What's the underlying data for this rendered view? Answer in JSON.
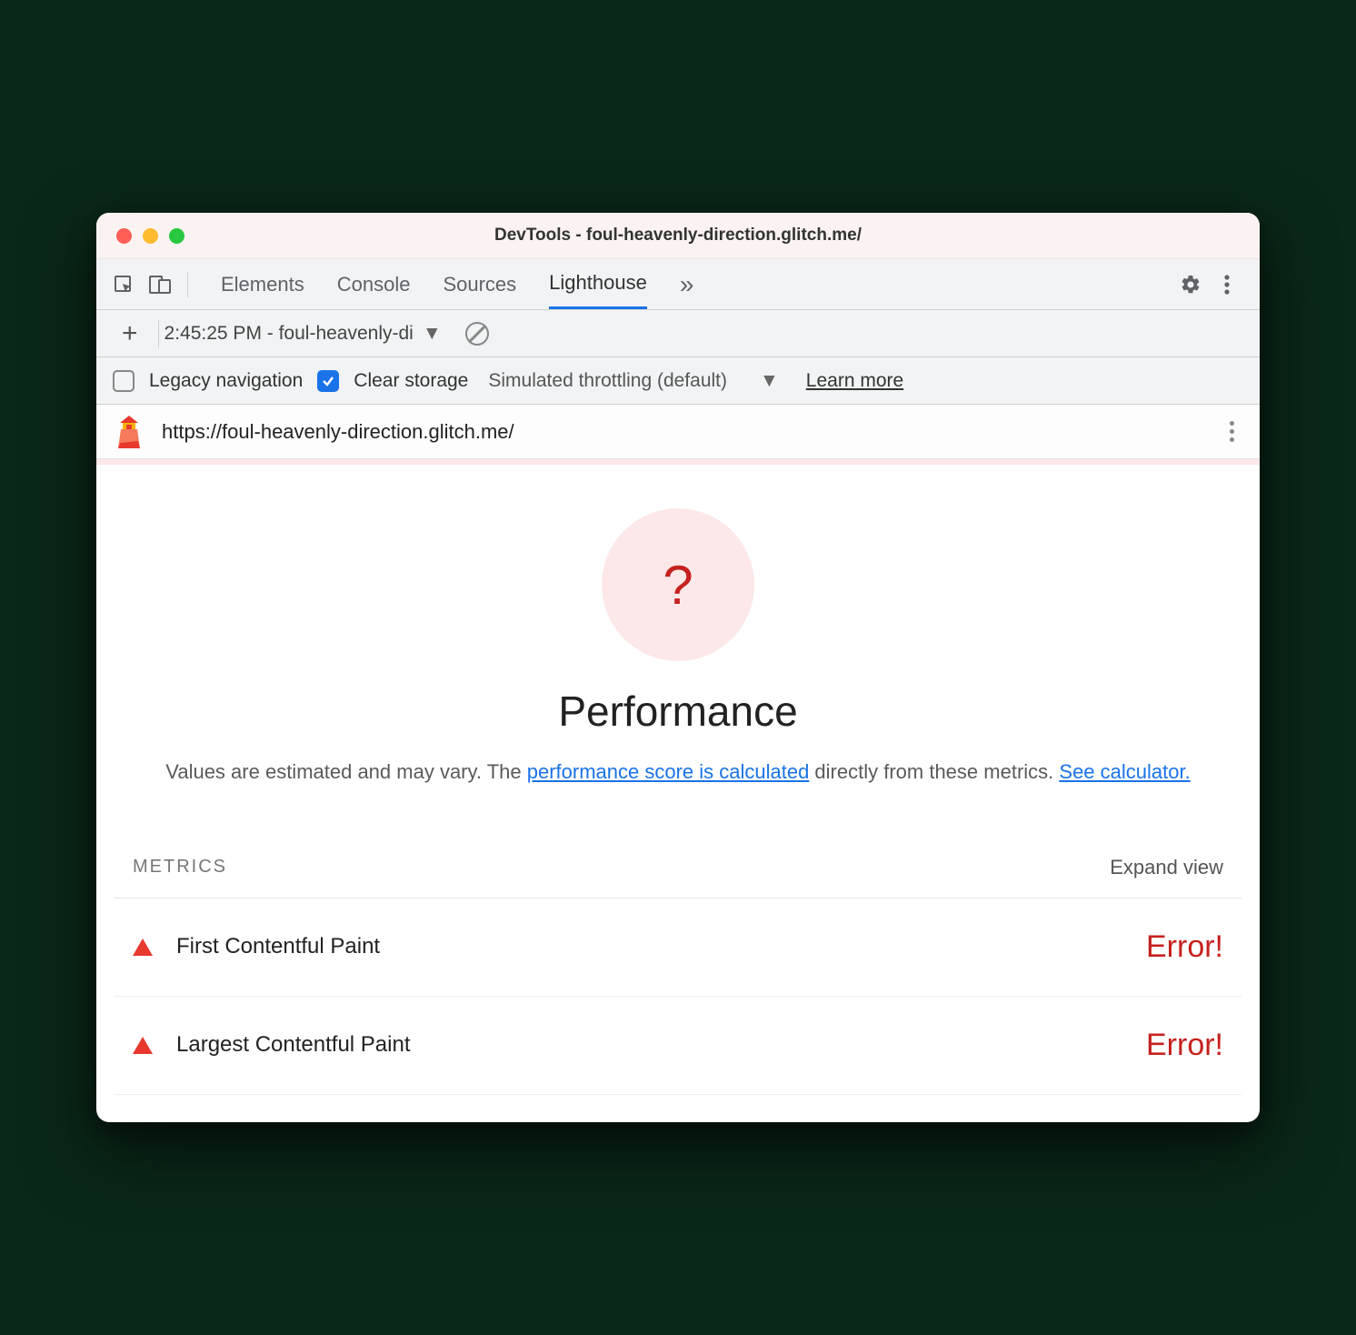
{
  "window": {
    "title": "DevTools - foul-heavenly-direction.glitch.me/"
  },
  "tabs": {
    "items": [
      "Elements",
      "Console",
      "Sources",
      "Lighthouse"
    ],
    "active": "Lighthouse"
  },
  "subbar": {
    "report_label": "2:45:25 PM - foul-heavenly-di"
  },
  "options": {
    "legacy_label": "Legacy navigation",
    "legacy_checked": false,
    "clear_label": "Clear storage",
    "clear_checked": true,
    "throttling_label": "Simulated throttling (default)",
    "learn_more": "Learn more"
  },
  "urlbar": {
    "url": "https://foul-heavenly-direction.glitch.me/"
  },
  "report": {
    "gauge_symbol": "?",
    "title": "Performance",
    "desc_prefix": "Values are estimated and may vary. The ",
    "desc_link1": "performance score is calculated",
    "desc_mid": " directly from these metrics. ",
    "desc_link2": "See calculator.",
    "metrics_label": "METRICS",
    "expand_label": "Expand view",
    "metrics": [
      {
        "name": "First Contentful Paint",
        "value": "Error!"
      },
      {
        "name": "Largest Contentful Paint",
        "value": "Error!"
      }
    ]
  }
}
